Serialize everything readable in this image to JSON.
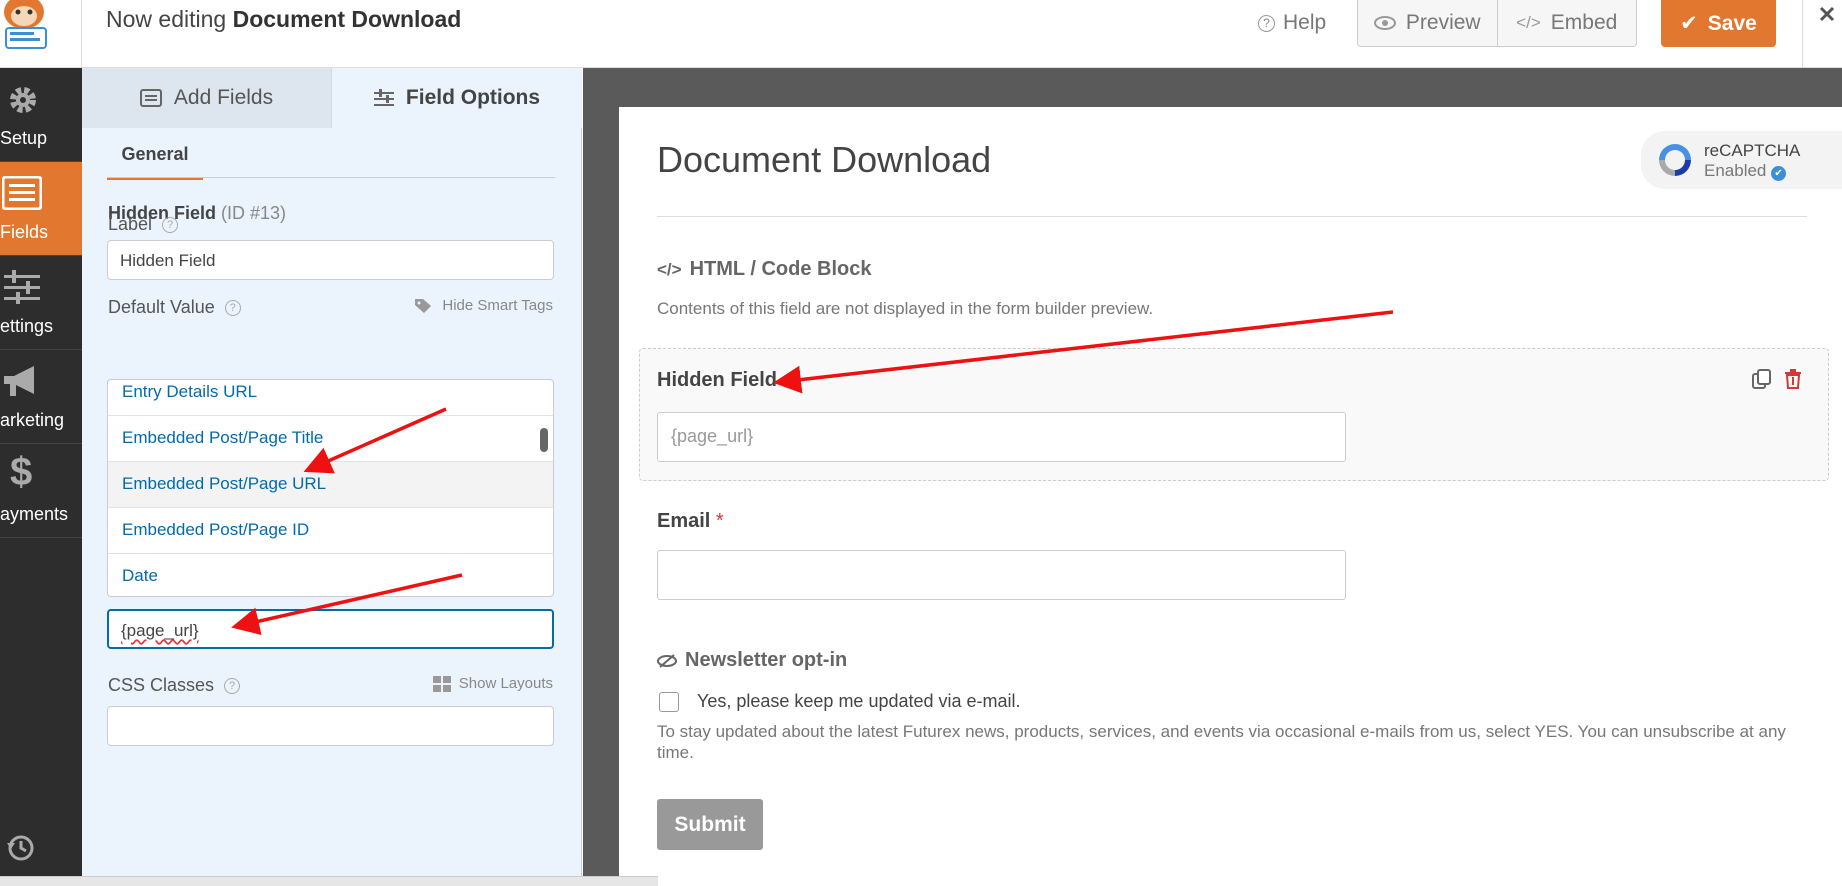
{
  "header": {
    "title_prefix": "Now editing",
    "title_form": "Document Download",
    "help_label": "Help",
    "preview_label": "Preview",
    "embed_label": "Embed",
    "save_label": "Save"
  },
  "nav": {
    "items": [
      {
        "label": "Setup",
        "icon": "gear-icon"
      },
      {
        "label": "Fields",
        "icon": "fields-list-icon"
      },
      {
        "label": "ettings",
        "icon": "sliders-icon"
      },
      {
        "label": "arketing",
        "icon": "megaphone-icon"
      },
      {
        "label": "ayments",
        "icon": "dollar-icon"
      }
    ],
    "history_icon": "history-icon"
  },
  "panel": {
    "tab_add": "Add Fields",
    "tab_options": "Field Options",
    "subtab_general": "General",
    "field_name": "Hidden Field",
    "field_id": "(ID #13)",
    "label_label": "Label",
    "label_value": "Hidden Field",
    "default_value_label": "Default Value",
    "hide_smart_tags": "Hide Smart Tags",
    "smart_tags": [
      "Entry Details URL",
      "Embedded Post/Page Title",
      "Embedded Post/Page URL",
      "Embedded Post/Page ID",
      "Date"
    ],
    "default_value": "{page_url}",
    "css_classes_label": "CSS Classes",
    "show_layouts": "Show Layouts",
    "css_classes_value": ""
  },
  "form": {
    "title": "Document Download",
    "recaptcha_title": "reCAPTCHA",
    "recaptcha_status": "Enabled",
    "html_block_title": "HTML / Code Block",
    "html_block_desc": "Contents of this field are not displayed in the form builder preview.",
    "hidden_label": "Hidden Field",
    "hidden_placeholder": "{page_url}",
    "email_label": "Email",
    "email_required_mark": "*",
    "newsletter_title": "Newsletter opt-in",
    "newsletter_checkbox": "Yes, please keep me updated via e-mail.",
    "newsletter_desc": "To stay updated about the latest Futurex news, products, services, and events via occasional e-mails from us, select YES. You can unsubscribe at any time.",
    "submit_label": "Submit"
  },
  "colors": {
    "accent": "#e27730",
    "link": "#036aab",
    "nav_bg": "#2d2d2d",
    "panel_bg": "#ebf3fc",
    "annotation_arrow": "#ee1111"
  }
}
